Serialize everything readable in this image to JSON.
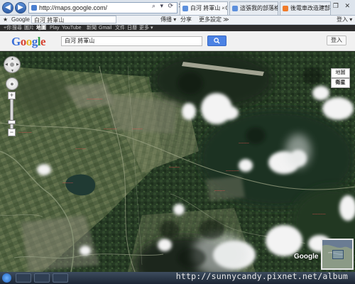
{
  "browser": {
    "back_icon": "back-arrow-icon",
    "forward_icon": "forward-arrow-icon",
    "address": "http://maps.google.com/",
    "address_tools": "⌕ ▾ ⟳ ✕",
    "tabs": [
      {
        "label": "白河 將軍山 - Google ..."
      },
      {
        "label": "這張我的部落格 - Yahoo!..."
      },
      {
        "label": "後電車改造建部 - Powere..."
      }
    ],
    "window_controls": "— ❐ ✕",
    "command_bar": {
      "favorites": "★",
      "google_label": "Google",
      "query": "白河 將軍山",
      "share": "分享",
      "more": "更多設定 ≫",
      "extra": "傳播 ▾",
      "login": "登入 ▾"
    }
  },
  "gbar": {
    "items": [
      "+你",
      "搜尋",
      "圖片",
      "地圖",
      "Play",
      "YouTube",
      "新聞",
      "Gmail",
      "文件",
      "日曆",
      "更多 ▾"
    ],
    "active": "地圖"
  },
  "search": {
    "logo": [
      "G",
      "o",
      "o",
      "g",
      "l",
      "e"
    ],
    "query": "白河 將軍山",
    "button_icon": "search-icon",
    "login_label": "登入"
  },
  "map": {
    "place_labels": [
      "──────",
      "─────",
      "────",
      "────",
      "─────",
      "────",
      "─────",
      "────",
      "─────",
      "────",
      "────"
    ],
    "type_buttons": [
      "地圖",
      "衛星"
    ],
    "zoom_in": "+",
    "zoom_out": "−",
    "corner_logo": "Google"
  },
  "watermark": "http://sunnycandy.pixnet.net/album"
}
